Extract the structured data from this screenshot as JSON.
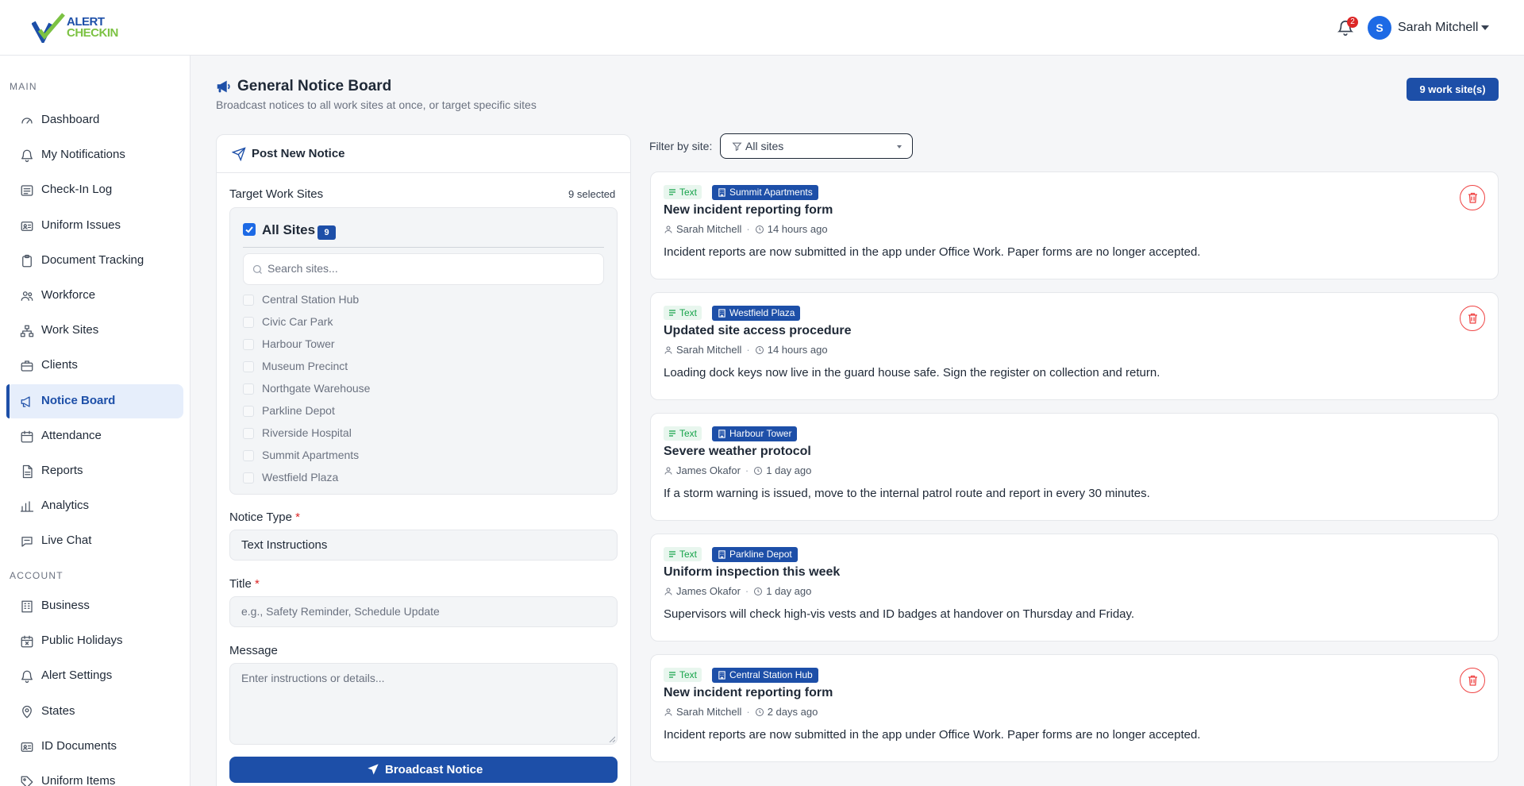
{
  "header": {
    "logo_line1": "ALERT",
    "logo_line2": "CHECKIN",
    "notification_count": "2",
    "user_initial": "S",
    "user_name": "Sarah Mitchell"
  },
  "sidebar": {
    "main_title": "MAIN",
    "account_title": "ACCOUNT",
    "main_items": [
      {
        "label": "Dashboard",
        "icon": "gauge-icon"
      },
      {
        "label": "My Notifications",
        "icon": "bell-icon"
      },
      {
        "label": "Check-In Log",
        "icon": "list-icon"
      },
      {
        "label": "Uniform Issues",
        "icon": "id-card-icon"
      },
      {
        "label": "Document Tracking",
        "icon": "clipboard-icon"
      },
      {
        "label": "Workforce",
        "icon": "users-icon"
      },
      {
        "label": "Work Sites",
        "icon": "sitemap-icon"
      },
      {
        "label": "Clients",
        "icon": "briefcase-icon"
      },
      {
        "label": "Notice Board",
        "icon": "megaphone-icon",
        "active": true
      },
      {
        "label": "Attendance",
        "icon": "calendar-icon"
      },
      {
        "label": "Reports",
        "icon": "file-icon"
      },
      {
        "label": "Analytics",
        "icon": "bar-chart-icon"
      },
      {
        "label": "Live Chat",
        "icon": "chat-icon"
      }
    ],
    "account_items": [
      {
        "label": "Business",
        "icon": "building-icon"
      },
      {
        "label": "Public Holidays",
        "icon": "calendar-x-icon"
      },
      {
        "label": "Alert Settings",
        "icon": "bell-icon"
      },
      {
        "label": "States",
        "icon": "map-pin-icon"
      },
      {
        "label": "ID Documents",
        "icon": "id-card-icon"
      },
      {
        "label": "Uniform Items",
        "icon": "tag-icon"
      }
    ]
  },
  "page": {
    "title": "General Notice Board",
    "subtitle": "Broadcast notices to all work sites at once, or target specific sites",
    "sites_badge": "9 work site(s)"
  },
  "post_form": {
    "title": "Post New Notice",
    "target_label": "Target Work Sites",
    "selected_count": "9 selected",
    "all_sites_label": "All Sites",
    "all_sites_count": "9",
    "search_placeholder": "Search sites...",
    "sites": [
      "Central Station Hub",
      "Civic Car Park",
      "Harbour Tower",
      "Museum Precinct",
      "Northgate Warehouse",
      "Parkline Depot",
      "Riverside Hospital",
      "Summit Apartments",
      "Westfield Plaza"
    ],
    "type_label": "Notice Type",
    "type_value": "Text Instructions",
    "title_label": "Title",
    "title_placeholder": "e.g., Safety Reminder, Schedule Update",
    "message_label": "Message",
    "message_placeholder": "Enter instructions or details...",
    "required_mark": "*",
    "submit_label": "Broadcast Notice"
  },
  "filter": {
    "label": "Filter by site:",
    "value": "All sites"
  },
  "notices": [
    {
      "type": "Text",
      "site": "Summit Apartments",
      "title": "New incident reporting form",
      "author": "Sarah Mitchell",
      "time": "14 hours ago",
      "body": "Incident reports are now submitted in the app under Office Work. Paper forms are no longer accepted.",
      "deletable": true
    },
    {
      "type": "Text",
      "site": "Westfield Plaza",
      "title": "Updated site access procedure",
      "author": "Sarah Mitchell",
      "time": "14 hours ago",
      "body": "Loading dock keys now live in the guard house safe. Sign the register on collection and return.",
      "deletable": true
    },
    {
      "type": "Text",
      "site": "Harbour Tower",
      "title": "Severe weather protocol",
      "author": "James Okafor",
      "time": "1 day ago",
      "body": "If a storm warning is issued, move to the internal patrol route and report in every 30 minutes.",
      "deletable": false
    },
    {
      "type": "Text",
      "site": "Parkline Depot",
      "title": "Uniform inspection this week",
      "author": "James Okafor",
      "time": "1 day ago",
      "body": "Supervisors will check high-vis vests and ID badges at handover on Thursday and Friday.",
      "deletable": false
    },
    {
      "type": "Text",
      "site": "Central Station Hub",
      "title": "New incident reporting form",
      "author": "Sarah Mitchell",
      "time": "2 days ago",
      "body": "Incident reports are now submitted in the app under Office Work. Paper forms are no longer accepted.",
      "deletable": true
    }
  ],
  "colors": {
    "brand_primary": "#1d4fa8",
    "brand_green": "#7cc243",
    "danger": "#ef4444",
    "success": "#16a34a"
  }
}
